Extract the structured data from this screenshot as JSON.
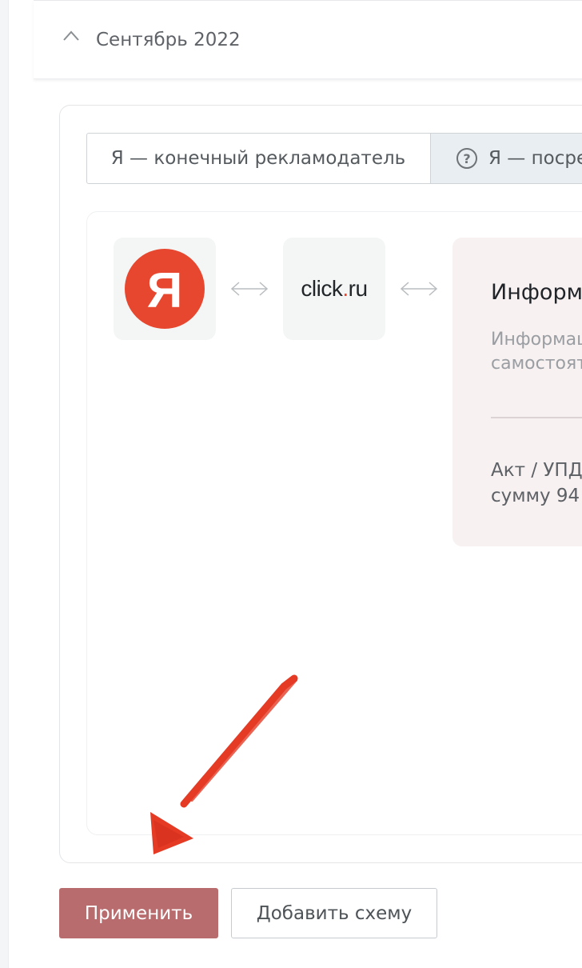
{
  "month_section": {
    "label": "Сентябрь 2022",
    "toggle_icon": "chevron-up-icon"
  },
  "role_switch": {
    "options": [
      {
        "label": "Я — конечный рекламодатель",
        "selected": false
      },
      {
        "label": "Я — посре",
        "selected": true,
        "icon": "help-icon"
      }
    ]
  },
  "scheme": {
    "nodes": [
      {
        "name": "yandex",
        "logo_text": "Я"
      },
      {
        "name": "click",
        "logo_text_main": "click",
        "logo_text_dot": ".",
        "logo_text_tail": "ru"
      }
    ],
    "info": {
      "title": "Информа",
      "description_lines": [
        "Информац",
        "самостоят"
      ],
      "act_lines": [
        "Акт / УПД",
        "сумму 94"
      ]
    }
  },
  "annotation": {
    "color": "#e53b25"
  },
  "actions": {
    "apply_label": "Применить",
    "add_scheme_label": "Добавить схему",
    "apply_color": "#b86c6d"
  }
}
